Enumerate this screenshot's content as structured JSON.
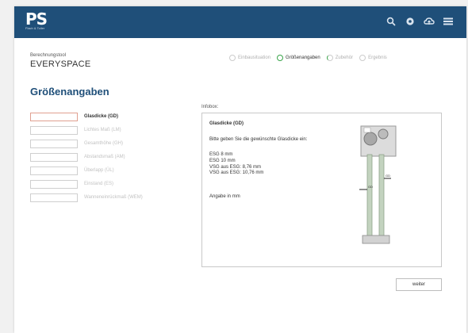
{
  "header": {
    "logo_mark": "PS",
    "logo_subtext": "Flach & Toller",
    "icons": [
      "search-icon",
      "settings-icon",
      "cloud-icon",
      "menu-icon"
    ],
    "bar_color": "#1f4f79"
  },
  "app": {
    "label": "Berechnungstool",
    "name": "EVERYSPACE"
  },
  "steps": [
    {
      "label": "Einbausituation",
      "state": "inactive"
    },
    {
      "label": "Größenangaben",
      "state": "active"
    },
    {
      "label": "Zubehör",
      "state": "partial"
    },
    {
      "label": "Ergebnis",
      "state": "inactive"
    }
  ],
  "main": {
    "heading": "Größenangaben",
    "fields": [
      {
        "label": "Glasdicke (GD)",
        "value": "",
        "active": true
      },
      {
        "label": "Lichtes Maß (LM)",
        "value": "",
        "active": false
      },
      {
        "label": "Gesamthöhe (GH)",
        "value": "",
        "active": false
      },
      {
        "label": "Abstandsmaß (AM)",
        "value": "",
        "active": false
      },
      {
        "label": "Überlapp (ÜL)",
        "value": "",
        "active": false
      },
      {
        "label": "Einstand (ES)",
        "value": "",
        "active": false
      },
      {
        "label": "Wanneneinrückmaß (WEM)",
        "value": "",
        "active": false
      }
    ]
  },
  "infobox": {
    "label": "Infobox:",
    "title": "Glasdicke (GD)",
    "intro": "Bitte geben Sie die gewünschte Glasdicke ein:",
    "options": [
      "ESG 8 mm",
      "ESG 10 mm",
      "VSG aus ESG: 8,76 mm",
      "VSG aus ESG: 10,76 mm"
    ],
    "unit_note": "Angabe in mm",
    "diagram_label": "GD"
  },
  "actions": {
    "next_label": "weiter"
  },
  "colors": {
    "accent": "#1f4f79",
    "active_step": "#3aa54a",
    "active_input_border": "#e0a090"
  }
}
